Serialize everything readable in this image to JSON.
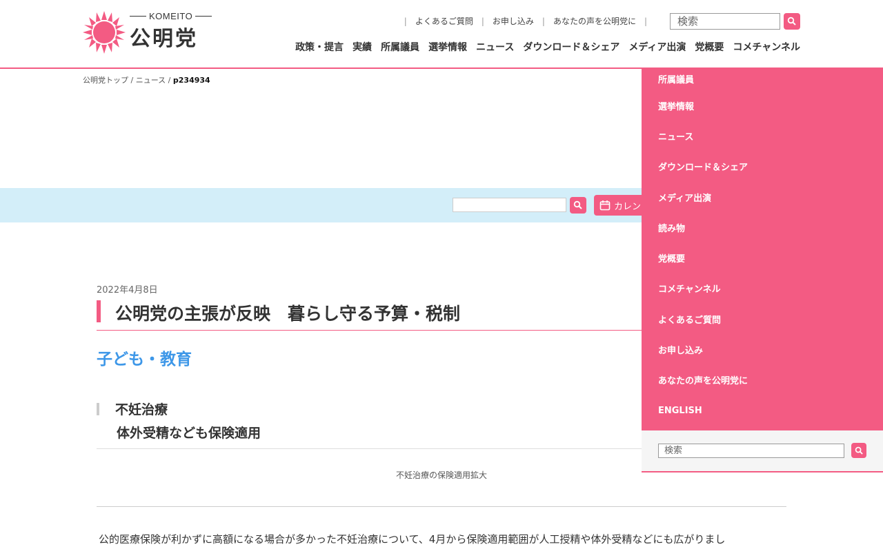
{
  "header": {
    "logo_en": "KOMEITO",
    "logo_jp": "公明党",
    "util_links": [
      "よくあるご質問",
      "お申し込み",
      "あなたの声を公明党に"
    ],
    "search_placeholder": "検索",
    "main_nav": [
      "政策・提言",
      "実績",
      "所属議員",
      "選挙情報",
      "ニュース",
      "ダウンロード＆シェア",
      "メディア出演",
      "党概要",
      "コメチャンネル"
    ]
  },
  "breadcrumb": {
    "home": "公明党トップ",
    "section": "ニュース",
    "current": "p234934",
    "separator": "/"
  },
  "toolbar": {
    "calendar_label": "カレン"
  },
  "article": {
    "date": "2022年4月8日",
    "title": "公明党の主張が反映　暮らし守る予算・税制",
    "category": "子ども・教育",
    "subheading_1": "不妊治療",
    "subheading_2": "体外受精なども保険適用",
    "caption": "不妊治療の保険適用拡大",
    "body": "公的医療保険が利かずに高額になる場合が多かった不妊治療について、4月から保険適用範囲が人工授精や体外受精などにも広がりまし"
  },
  "dropdown": {
    "items": [
      "所属議員",
      "選挙情報",
      "ニュース",
      "ダウンロード＆シェア",
      "メディア出演",
      "読み物",
      "党概要",
      "コメチャンネル",
      "よくあるご質問",
      "お申し込み",
      "あなたの声を公明党に",
      "ENGLISH"
    ],
    "search_placeholder": "検索"
  },
  "colors": {
    "brand_pink": "#f35b83",
    "category_blue": "#3d97e8",
    "toolbar_bg": "#d3eef9"
  }
}
